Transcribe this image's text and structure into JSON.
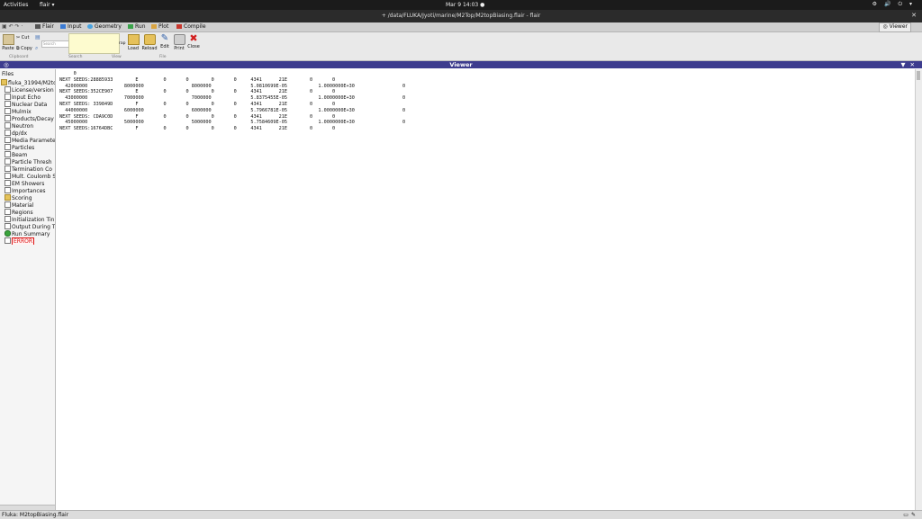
{
  "topbar": {
    "activities": "Activities",
    "app_menu": "flair ▾",
    "clock": "Mar 9  14:03  ●",
    "tray": "⚙ 🔊 ⏻ ▾"
  },
  "window": {
    "title": "+ /data/FLUKA/Jyoti/marine/M2Top/M2topBiasing.flair - flair",
    "close": "✕"
  },
  "menubar": {
    "tabs": [
      {
        "label": "Flair",
        "color": "#555"
      },
      {
        "label": "Input",
        "color": "#3a7bd5"
      },
      {
        "label": "Geometry",
        "color": "#4aa3df"
      },
      {
        "label": "Run",
        "color": "#3aa34a"
      },
      {
        "label": "Plot",
        "color": "#d9a441"
      },
      {
        "label": "Compile",
        "color": "#c8372d"
      }
    ],
    "viewer_tab": "Viewer"
  },
  "ribbon": {
    "paste": "Paste",
    "cut": "Cut",
    "copy": "Copy",
    "search_placeholder": "Search",
    "wrap": "rap",
    "load": "Load",
    "reload": "Reload",
    "edit": "Edit",
    "print": "Print",
    "close": "Close",
    "groups": [
      "Clipboard",
      "Search",
      "View",
      "File"
    ]
  },
  "viewer": {
    "title": "Viewer",
    "left_icon": "◎",
    "right_icons": "▼✕"
  },
  "tree": {
    "header": "Files",
    "items": [
      {
        "label": "fluka_31994/M2to",
        "kind": "folder"
      },
      {
        "label": "License/version",
        "kind": "file"
      },
      {
        "label": "Input Echo",
        "kind": "file"
      },
      {
        "label": "Nuclear Data",
        "kind": "file"
      },
      {
        "label": "Mulmix",
        "kind": "file"
      },
      {
        "label": "Products/Decay",
        "kind": "file"
      },
      {
        "label": "Neutron",
        "kind": "file"
      },
      {
        "label": "dp/dx",
        "kind": "file"
      },
      {
        "label": "Media Paramete",
        "kind": "file"
      },
      {
        "label": "Particles",
        "kind": "file"
      },
      {
        "label": "Beam",
        "kind": "file"
      },
      {
        "label": "Particle Thresh",
        "kind": "file"
      },
      {
        "label": "Termination Co",
        "kind": "file"
      },
      {
        "label": "Mult. Coulomb S",
        "kind": "file"
      },
      {
        "label": "EM Showers",
        "kind": "file"
      },
      {
        "label": "Importances",
        "kind": "file"
      },
      {
        "label": "Scoring",
        "kind": "folder"
      },
      {
        "label": "Material",
        "kind": "file"
      },
      {
        "label": "Regions",
        "kind": "file"
      },
      {
        "label": "Initialization Tin",
        "kind": "file"
      },
      {
        "label": "Output During T",
        "kind": "file"
      },
      {
        "label": "Run Summary",
        "kind": "runsum"
      },
      {
        "label": "ERROR",
        "kind": "error"
      }
    ]
  },
  "output_text": "     0\nNEXT SEEDS:28885933        E         0       0        0       0     4341      21E        0       0\n  42000000             8000000                 8000000              5.0810699E-05           1.0000000E+30                 0\nNEXT SEEDS:352CE907        E         0       0        0       0     4341      21E        0       0\n  43000000             7000000                 7000000              5.8375455E-05           1.0000000E+30                 0\nNEXT SEEDS: 339849D        F         0       0        0       0     4341      21E        0       0\n  44000000             6000000                 6000000              5.7966781E-05           1.0000000E+30                 0\nNEXT SEEDS: CDA9C0D        F         0       0        0       0     4341      21E        0       0\n  45000000             5000000                 5000000              5.7584609E-05           1.0000000E+30                 0\nNEXT SEEDS:16764DBC        F         0       0        0       0     4341      21E        0       0",
  "statusbar": {
    "text": "Fluka: M2topBiasing.flair",
    "icons": "▭✎"
  }
}
